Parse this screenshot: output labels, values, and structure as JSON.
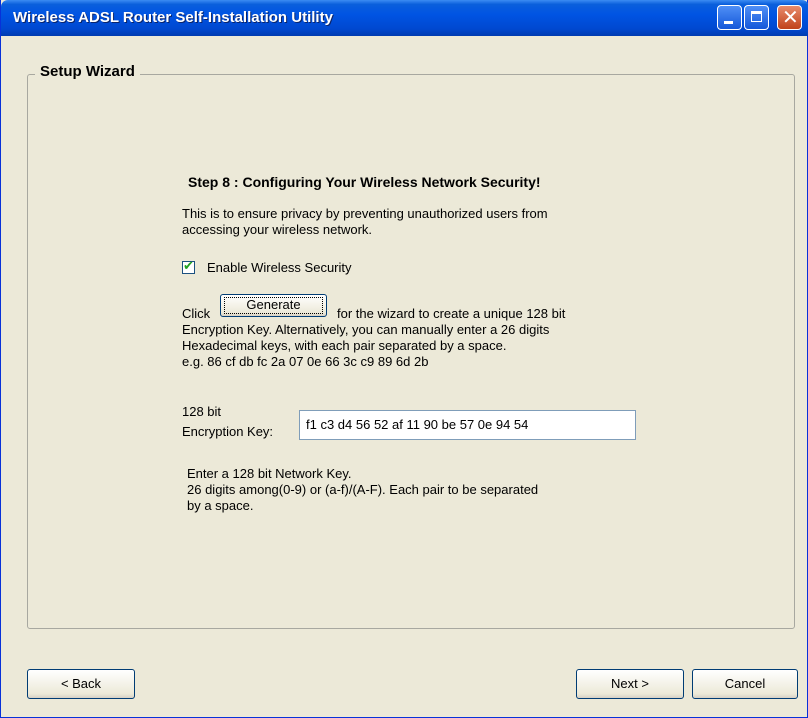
{
  "window": {
    "title": "Wireless ADSL Router Self-Installation Utility"
  },
  "wizard": {
    "group_label": "Setup Wizard",
    "step_heading": "Step 8 : Configuring Your Wireless Network Security!",
    "intro_lines": [
      "This is to ensure privacy by preventing unauthorized users from",
      "accessing your wireless network."
    ],
    "enable_security": {
      "label": "Enable Wireless Security",
      "checked": true
    },
    "click_prefix": "Click",
    "generate_label": "Generate",
    "click_suffix": "for the wizard to create a unique 128 bit",
    "desc_lines": [
      "Encryption Key. Alternatively, you can manually enter a 26 digits",
      "Hexadecimal keys, with each pair separated by a space.",
      "e.g. 86 cf db fc 2a 07 0e 66 3c c9 89 6d 2b"
    ],
    "key_label_lines": [
      "128 bit",
      "Encryption Key:"
    ],
    "key_value": "f1 c3 d4 56 52 af 11 90 be 57 0e 94 54",
    "hint_lines": [
      "Enter a 128 bit Network Key.",
      "26 digits among(0-9) or (a-f)/(A-F). Each pair to be separated",
      "by a space."
    ]
  },
  "buttons": {
    "back": "< Back",
    "next": "Next >",
    "cancel": "Cancel"
  }
}
